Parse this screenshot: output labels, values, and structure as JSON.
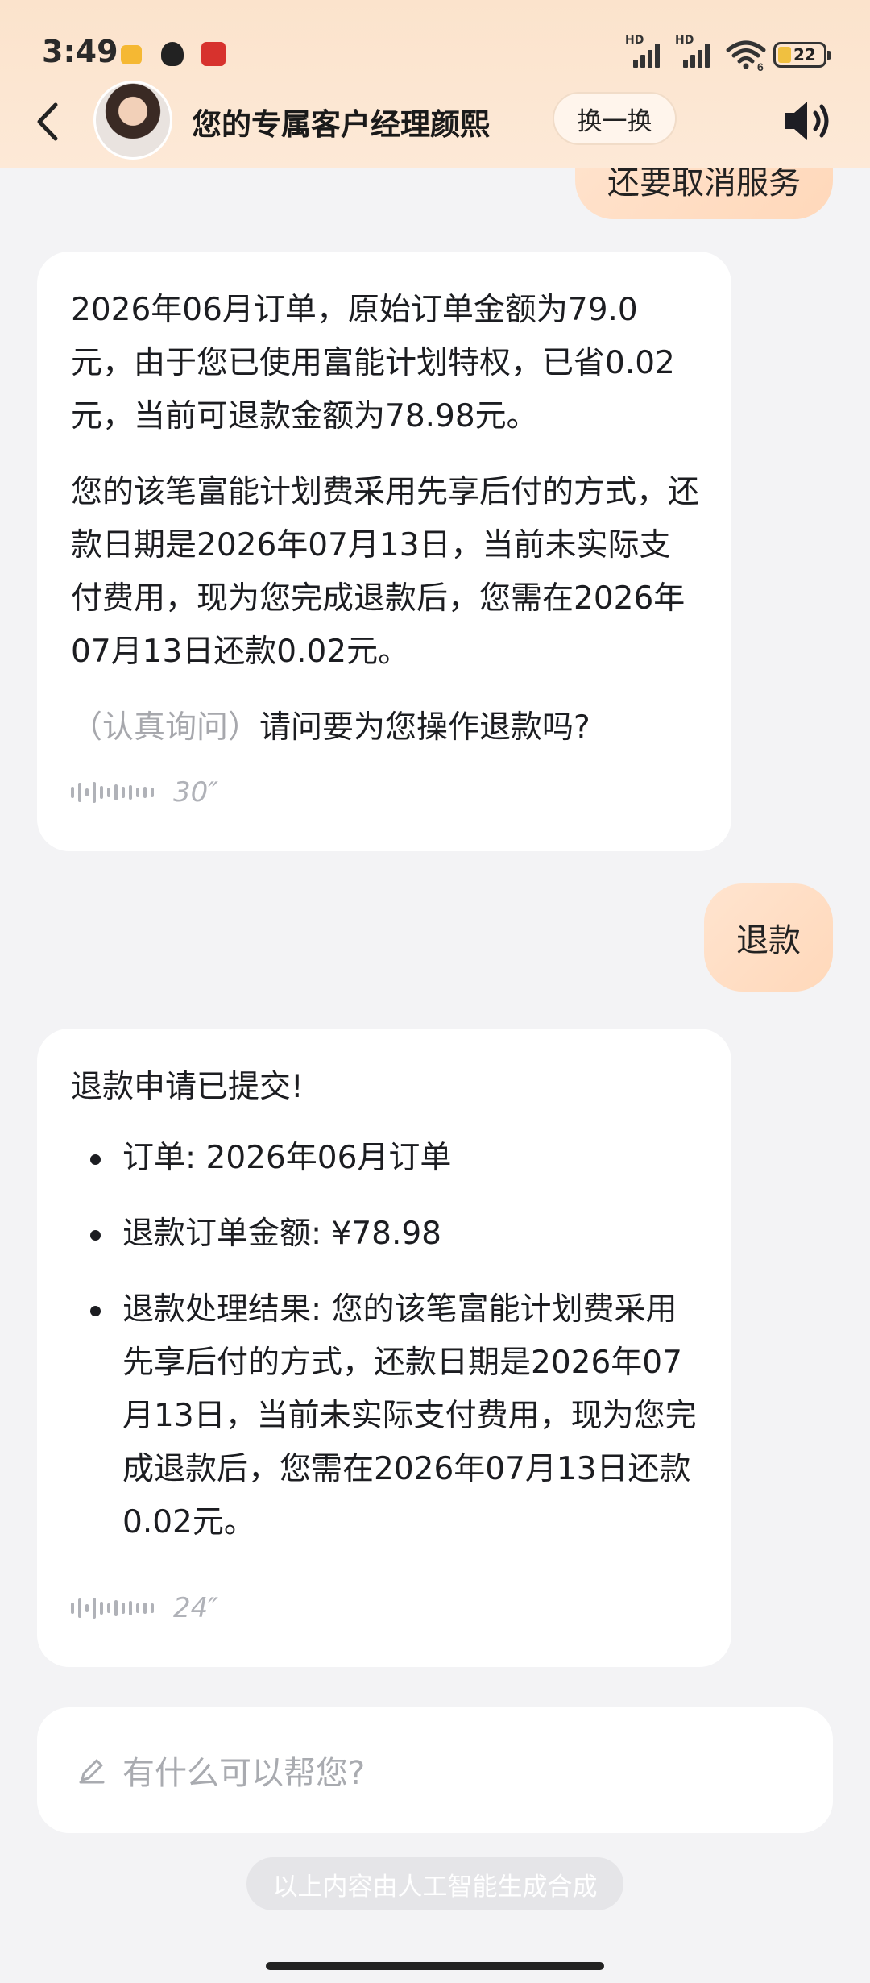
{
  "status_bar": {
    "time": "3:49",
    "network_badge_1": "HD",
    "network_badge_2": "HD",
    "wifi_badge": "6",
    "battery": "22"
  },
  "header": {
    "title": "您的专属客户经理颜熙",
    "switch_label": "换一换",
    "icons": [
      "back-icon",
      "avatar",
      "speaker-icon"
    ]
  },
  "chat": {
    "prev_user_message_partial": "还要取消服务",
    "ai_message_1": {
      "p1": "2026年06月订单，原始订单金额为79.0元，由于您已使用富能计划特权，已省0.02元，当前可退款金额为78.98元。",
      "p2": "您的该笔富能计划费采用先享后付的方式，还款日期是2026年07月13日，当前未实际支付费用，现为您完成退款后，您需在2026年07月13日还款0.02元。",
      "p3_tone": "（认真询问）",
      "p3_text": "请问要为您操作退款吗?",
      "voice_duration": "30″"
    },
    "user_message": "退款",
    "ai_message_2": {
      "headline": "退款申请已提交!",
      "bullets": [
        "订单: 2026年06月订单",
        "退款订单金额: ¥78.98",
        "退款处理结果: 您的该笔富能计划费采用先享后付的方式，还款日期是2026年07月13日，当前未实际支付费用，现为您完成退款后，您需在2026年07月13日还款0.02元。"
      ],
      "voice_duration": "24″"
    }
  },
  "input": {
    "placeholder": "有什么可以帮您?"
  },
  "footer_note": "以上内容由人工智能生成合成",
  "colors": {
    "header_bg": "#fde9d7",
    "user_bubble": "#ffd8ba",
    "page_bg": "#f3f3f5"
  }
}
